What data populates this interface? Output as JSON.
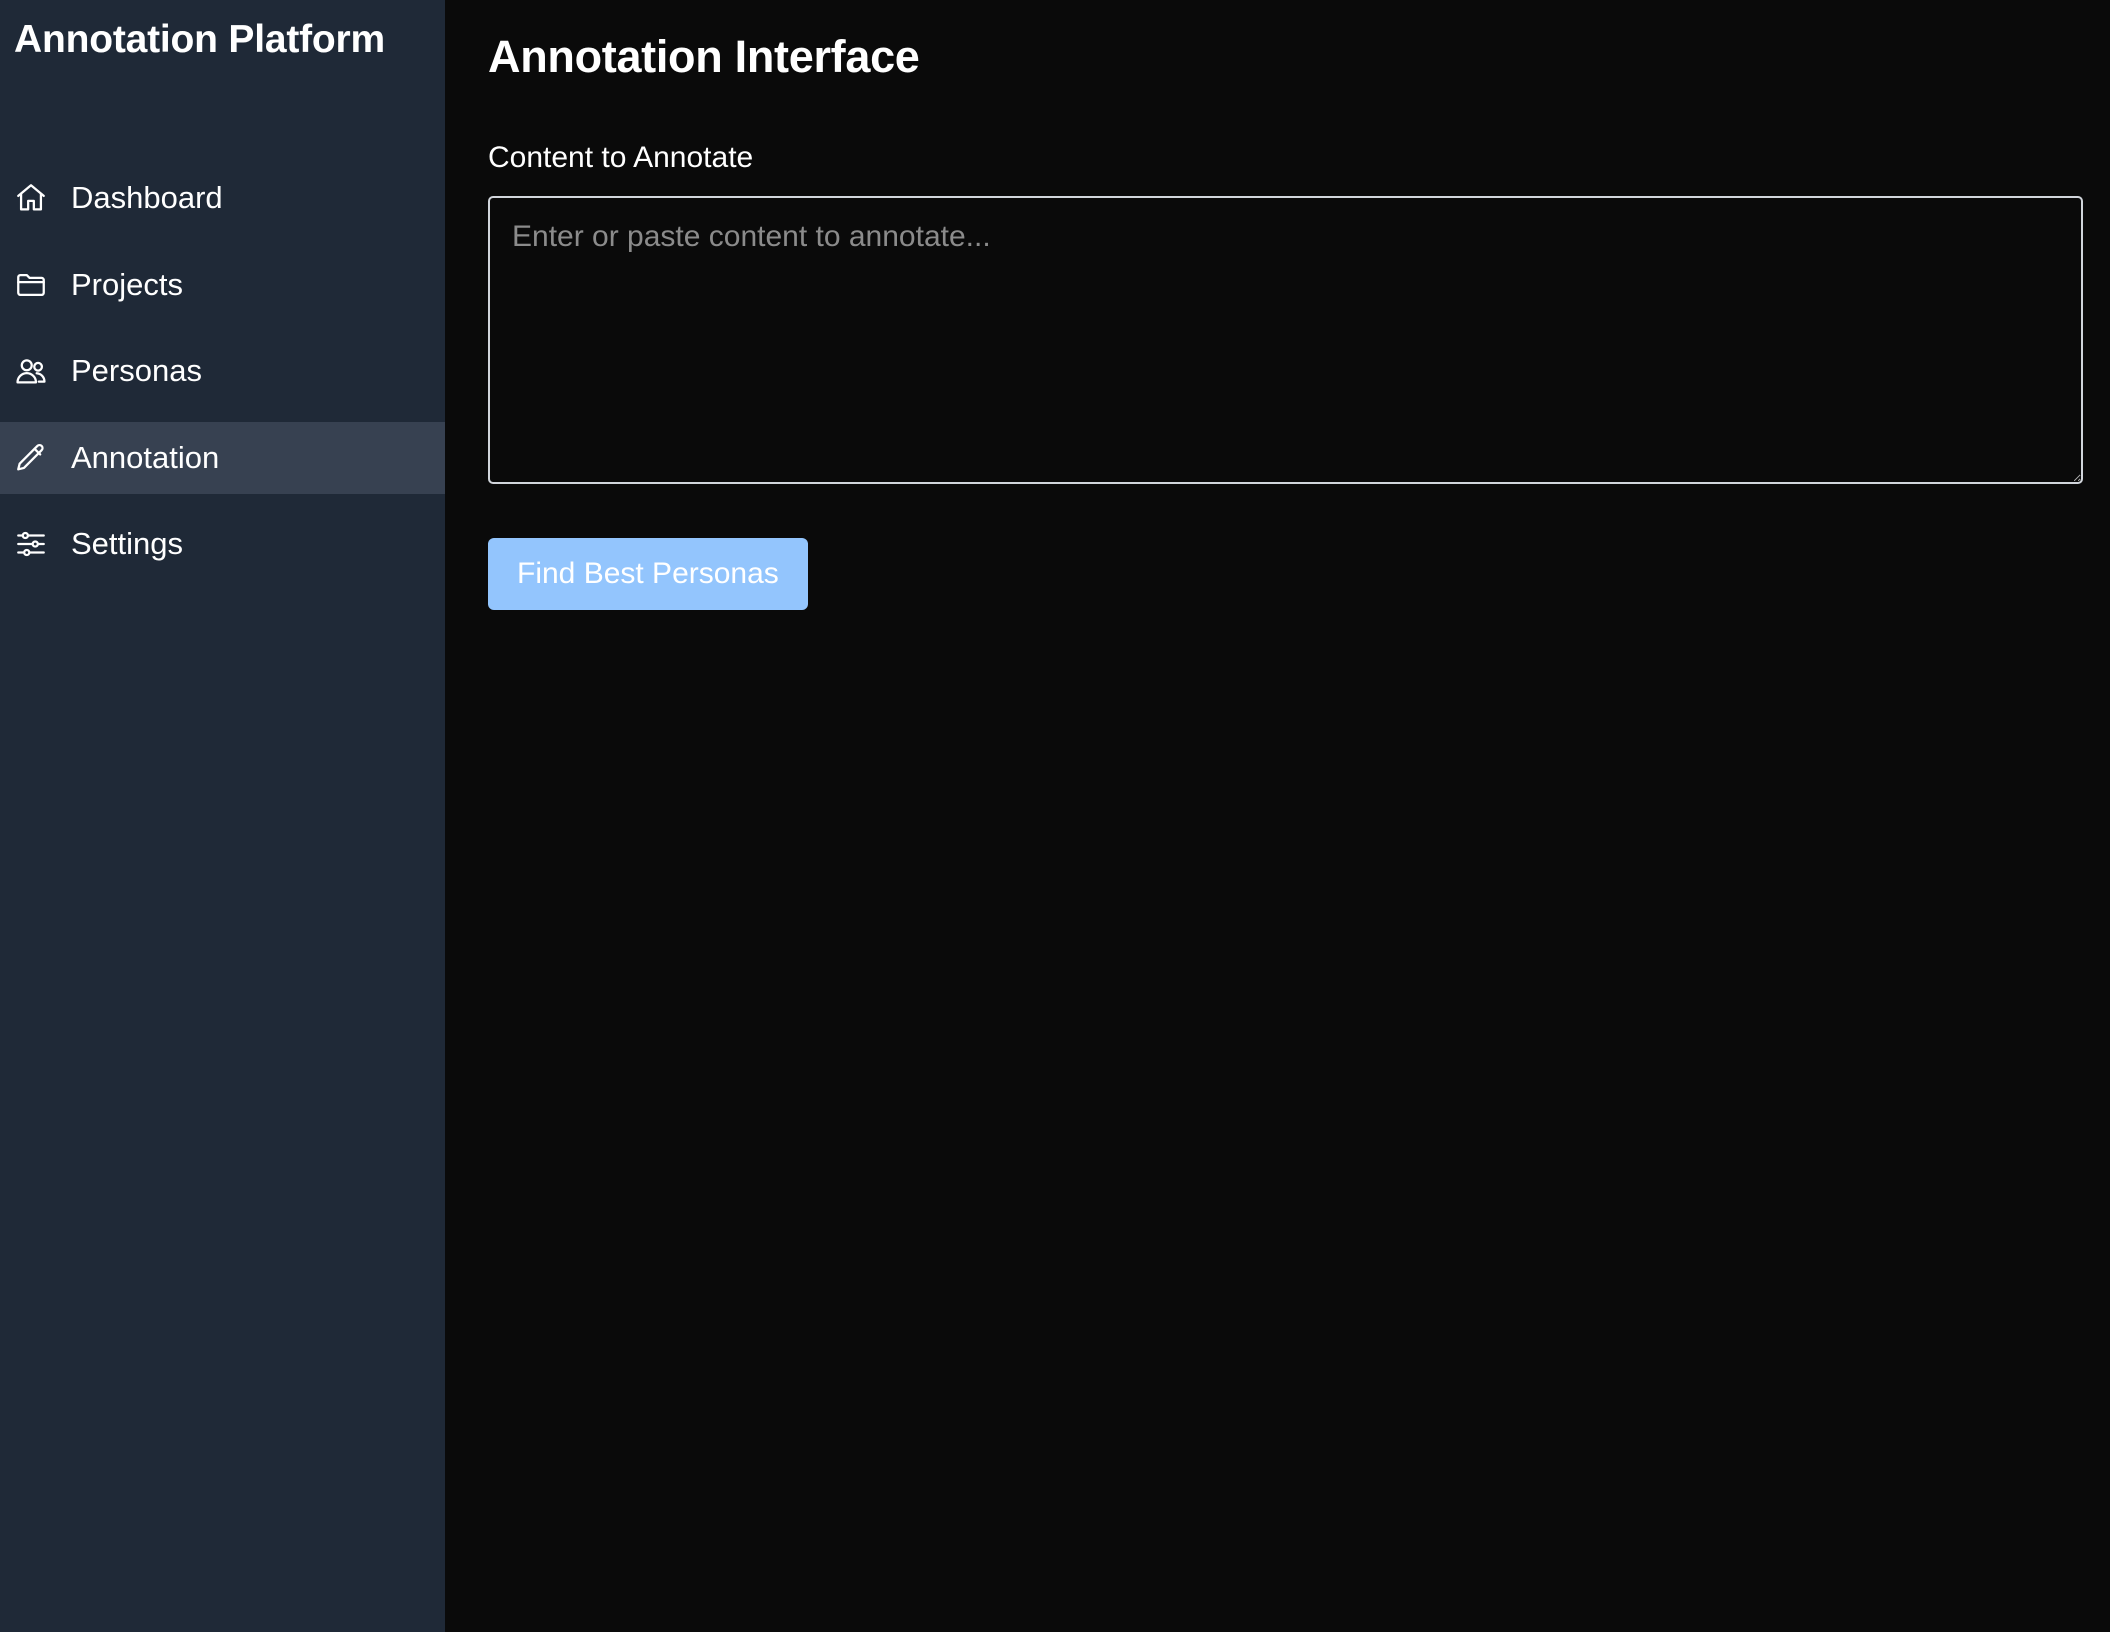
{
  "sidebar": {
    "title": "Annotation Platform",
    "items": [
      {
        "label": "Dashboard",
        "icon": "home-icon"
      },
      {
        "label": "Projects",
        "icon": "folder-icon"
      },
      {
        "label": "Personas",
        "icon": "users-icon"
      },
      {
        "label": "Annotation",
        "icon": "pencil-icon",
        "active": true
      },
      {
        "label": "Settings",
        "icon": "sliders-icon"
      }
    ]
  },
  "main": {
    "title": "Annotation Interface",
    "content_label": "Content to Annotate",
    "content_value": "",
    "content_placeholder": "Enter or paste content to annotate...",
    "find_button_label": "Find Best Personas"
  },
  "colors": {
    "sidebar_bg": "#1f2937",
    "sidebar_active_bg": "#374151",
    "main_bg": "#0a0a0a",
    "button_bg": "#93c5fd",
    "text": "#ffffff"
  }
}
